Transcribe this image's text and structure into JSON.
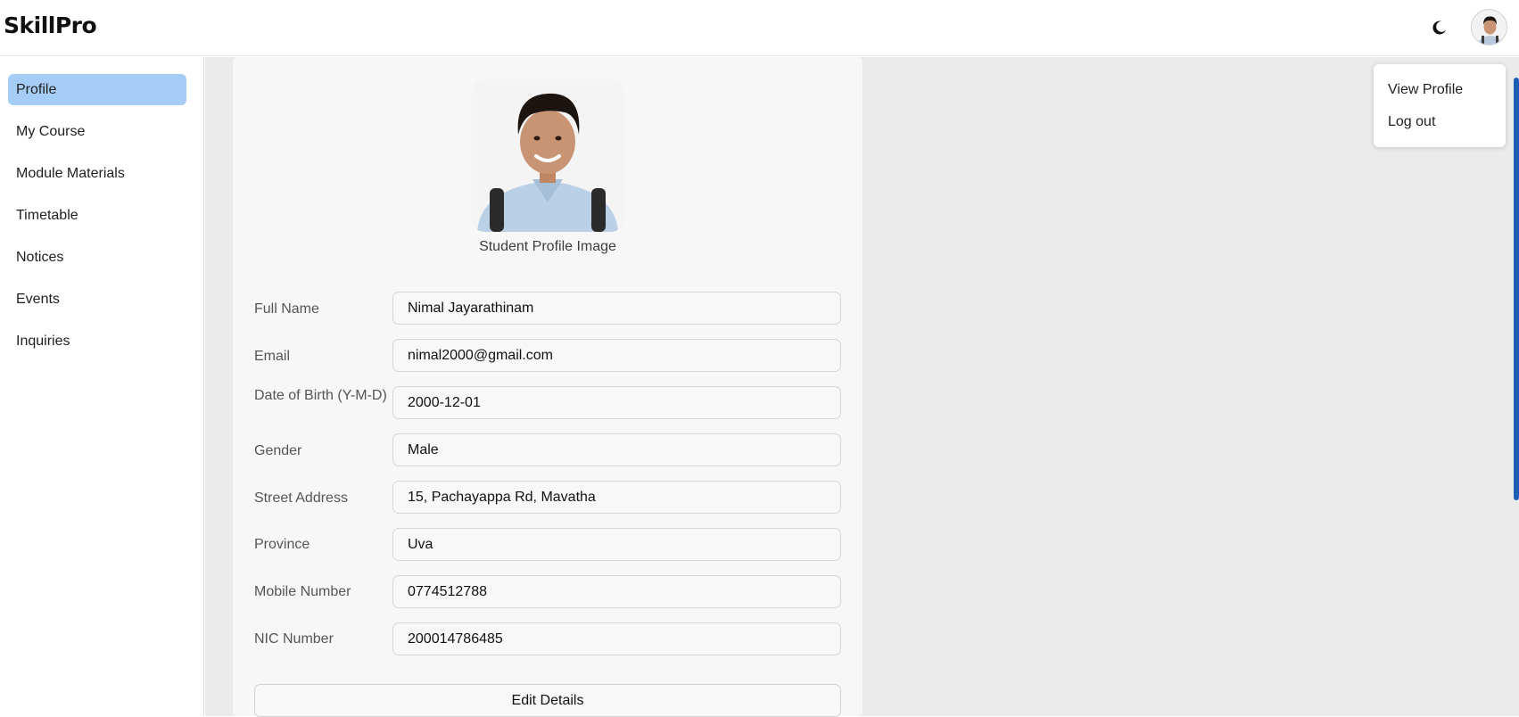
{
  "app": {
    "brand": "SkillPro"
  },
  "header": {
    "theme_icon": "moon-icon",
    "avatar_icon": "user-avatar"
  },
  "sidebar": {
    "items": [
      {
        "label": "Profile",
        "active": true
      },
      {
        "label": "My Course"
      },
      {
        "label": "Module Materials"
      },
      {
        "label": "Timetable"
      },
      {
        "label": "Notices"
      },
      {
        "label": "Events"
      },
      {
        "label": "Inquiries"
      }
    ]
  },
  "profile": {
    "image_caption": "Student Profile Image",
    "fields": [
      {
        "label": "Full Name",
        "value": "Nimal Jayarathinam"
      },
      {
        "label": "Email",
        "value": "nimal2000@gmail.com"
      },
      {
        "label": "Date of Birth (Y-M-D)",
        "value": "2000-12-01"
      },
      {
        "label": "Gender",
        "value": "Male"
      },
      {
        "label": "Street Address",
        "value": "15, Pachayappa Rd, Mavatha"
      },
      {
        "label": "Province",
        "value": "Uva"
      },
      {
        "label": "Mobile Number",
        "value": "0774512788"
      },
      {
        "label": "NIC Number",
        "value": "200014786485"
      }
    ],
    "edit_label": "Edit Details"
  },
  "dropdown": {
    "items": [
      {
        "label": "View Profile"
      },
      {
        "label": "Log out"
      }
    ]
  },
  "colors": {
    "active_nav": "#a6cdf8",
    "scroll_thumb": "#1f5fb3",
    "content_bg": "#ebebeb"
  }
}
